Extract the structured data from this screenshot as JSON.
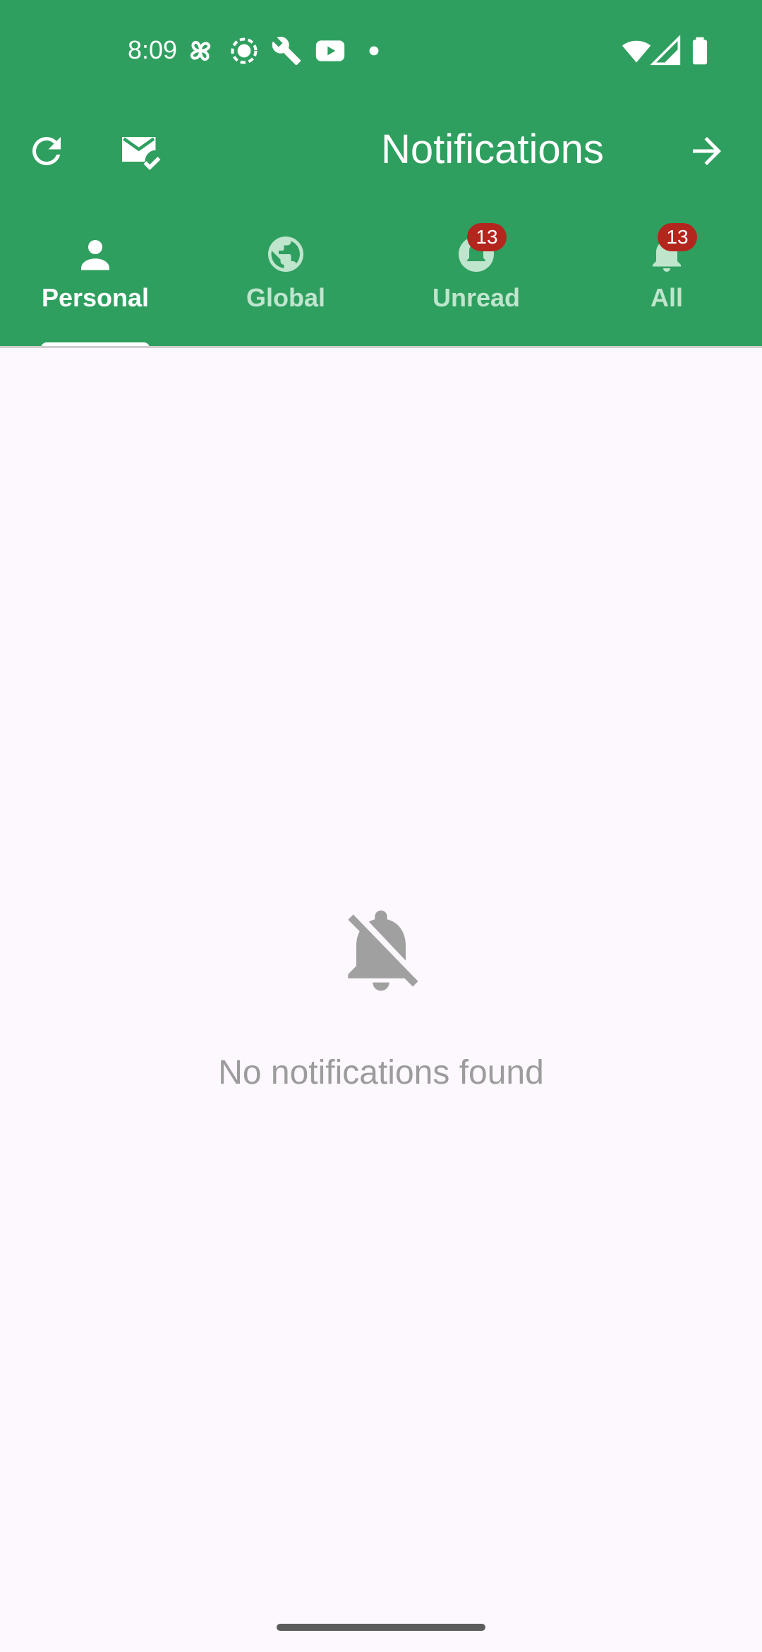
{
  "status_bar": {
    "time": "8:09",
    "left_icons": [
      "pinwheel-icon",
      "record-icon",
      "wrench-icon",
      "youtube-icon",
      "dot-icon"
    ],
    "right_icons": [
      "wifi-icon",
      "signal-icon",
      "battery-icon"
    ]
  },
  "app_bar": {
    "title": "Notifications",
    "actions": [
      "refresh-icon",
      "mark-all-read-icon",
      "arrow-forward-icon"
    ]
  },
  "tabs": [
    {
      "label": "Personal",
      "icon": "person-icon",
      "active": true
    },
    {
      "label": "Global",
      "icon": "globe-icon",
      "active": false
    },
    {
      "label": "Unread",
      "icon": "bell-icon",
      "badge": "13",
      "active": false
    },
    {
      "label": "All",
      "icon": "bell-icon",
      "badge": "13",
      "active": false
    }
  ],
  "empty_state": {
    "icon": "notifications-off-icon",
    "message": "No notifications found"
  },
  "colors": {
    "primary": "#2f9f5f",
    "background": "#fdf7fe",
    "badge": "#b3261e",
    "muted_text": "#9c9c9c"
  }
}
